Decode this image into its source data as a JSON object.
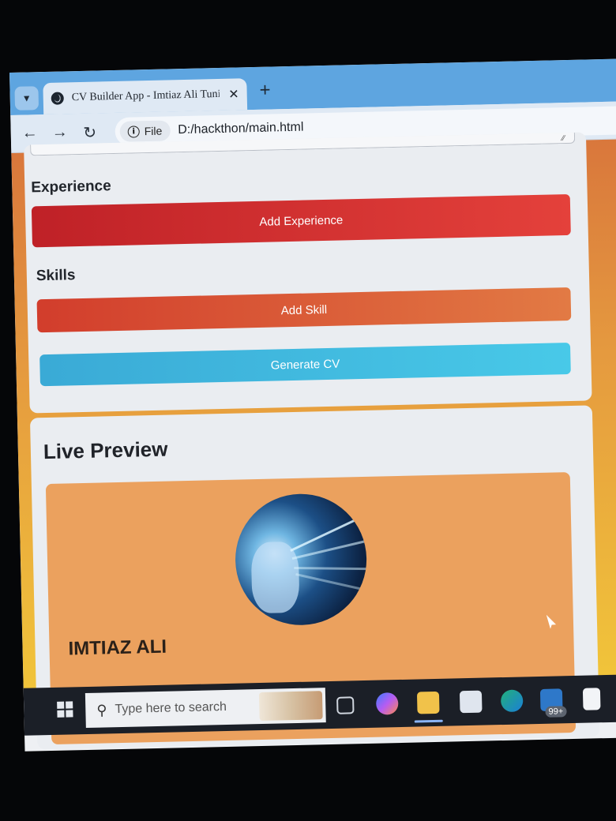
{
  "browser": {
    "tab_title": "CV Builder App - Imtiaz Ali Tuni",
    "site_chip": "File",
    "url": "D:/hackthon/main.html"
  },
  "form": {
    "experience_heading": "Experience",
    "add_experience_label": "Add Experience",
    "skills_heading": "Skills",
    "add_skill_label": "Add Skill",
    "generate_label": "Generate CV"
  },
  "preview": {
    "heading": "Live Preview",
    "name": "IMTIAZ ALI"
  },
  "taskbar": {
    "search_placeholder": "Type here to search",
    "badge": "99+"
  },
  "colors": {
    "add_experience": "#d63233",
    "add_skill": "#dc5b36",
    "generate": "#40bbe0",
    "cv_card": "#eba15e"
  }
}
